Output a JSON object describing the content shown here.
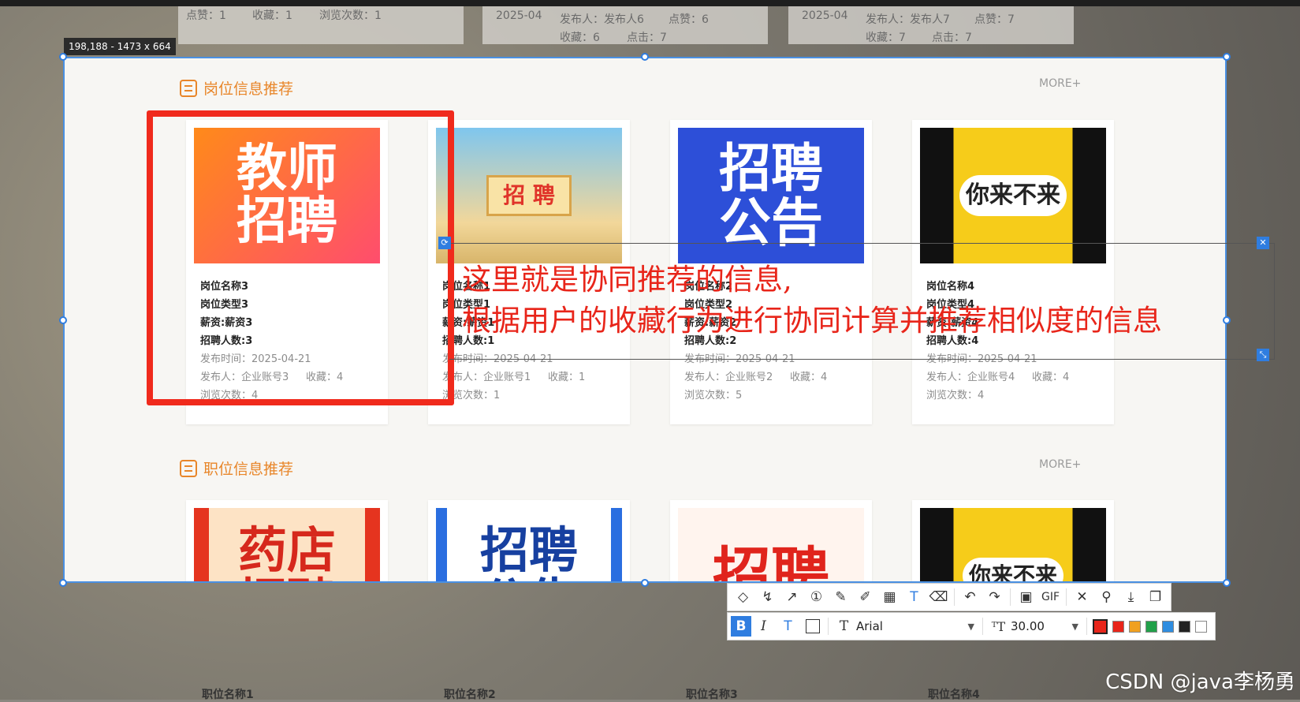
{
  "tool": {
    "size_label": "198,188 - 1473 x 664"
  },
  "background": {
    "top_cards": [
      {
        "likes": "点赞：1",
        "favorites": "收藏：1",
        "views": "浏览次数：1"
      },
      {
        "date": "2025-04",
        "publisher": "发布人：发布人6",
        "likes": "点赞：6",
        "favorites": "收藏：6",
        "clicks": "点击：7"
      },
      {
        "date": "2025-04",
        "publisher": "发布人：发布人7",
        "likes": "点赞：7",
        "favorites": "收藏：7",
        "clicks": "点击：7"
      }
    ]
  },
  "sections": [
    {
      "title": "岗位信息推荐",
      "more": "MORE+",
      "cards": [
        {
          "poster": "教师\n招聘",
          "name": "岗位名称3",
          "type": "岗位类型3",
          "salary": "薪资:薪资3",
          "count": "招聘人数:3",
          "time": "发布时间：2025-04-21",
          "publisher": "发布人：企业账号3",
          "favorites": "收藏：4",
          "views": "浏览次数：4"
        },
        {
          "poster": "招 聘",
          "name": "岗位名称1",
          "type": "岗位类型1",
          "salary": "薪资:薪资1",
          "count": "招聘人数:1",
          "time": "发布时间：2025-04-21",
          "publisher": "发布人：企业账号1",
          "favorites": "收藏：1",
          "views": "浏览次数：1"
        },
        {
          "poster": "招聘\n公告",
          "name": "岗位名称2",
          "type": "岗位类型2",
          "salary": "薪资:薪资2",
          "count": "招聘人数:2",
          "time": "发布时间：2025-04-21",
          "publisher": "发布人：企业账号2",
          "favorites": "收藏：4",
          "views": "浏览次数：5"
        },
        {
          "poster": "你来不来",
          "name": "岗位名称4",
          "type": "岗位类型4",
          "salary": "薪资:薪资4",
          "count": "招聘人数:4",
          "time": "发布时间：2025-04-21",
          "publisher": "发布人：企业账号4",
          "favorites": "收藏：4",
          "views": "浏览次数：4"
        }
      ]
    },
    {
      "title": "职位信息推荐",
      "more": "MORE+",
      "cards": [
        {
          "poster": "药店\n招聘",
          "name": "职位名称1"
        },
        {
          "poster": "招聘\n公告",
          "name": "职位名称2"
        },
        {
          "poster": "招聘",
          "name": "职位名称3"
        },
        {
          "poster": "你来不来",
          "name": "职位名称4"
        }
      ]
    }
  ],
  "annotation": {
    "line1": "这里就是协同推荐的信息,",
    "line2": "根据用户的收藏行为进行协同计算并推荐相似度的信息",
    "color": "#e8251a"
  },
  "toolbar": {
    "font_name": "Arial",
    "font_size": "30.00",
    "gif_label": "GIF",
    "colors": [
      "#e8251a",
      "#f0a020",
      "#22a04a",
      "#2f8de0",
      "#222222",
      "#ffffff"
    ]
  },
  "watermark": "CSDN @java李杨勇"
}
